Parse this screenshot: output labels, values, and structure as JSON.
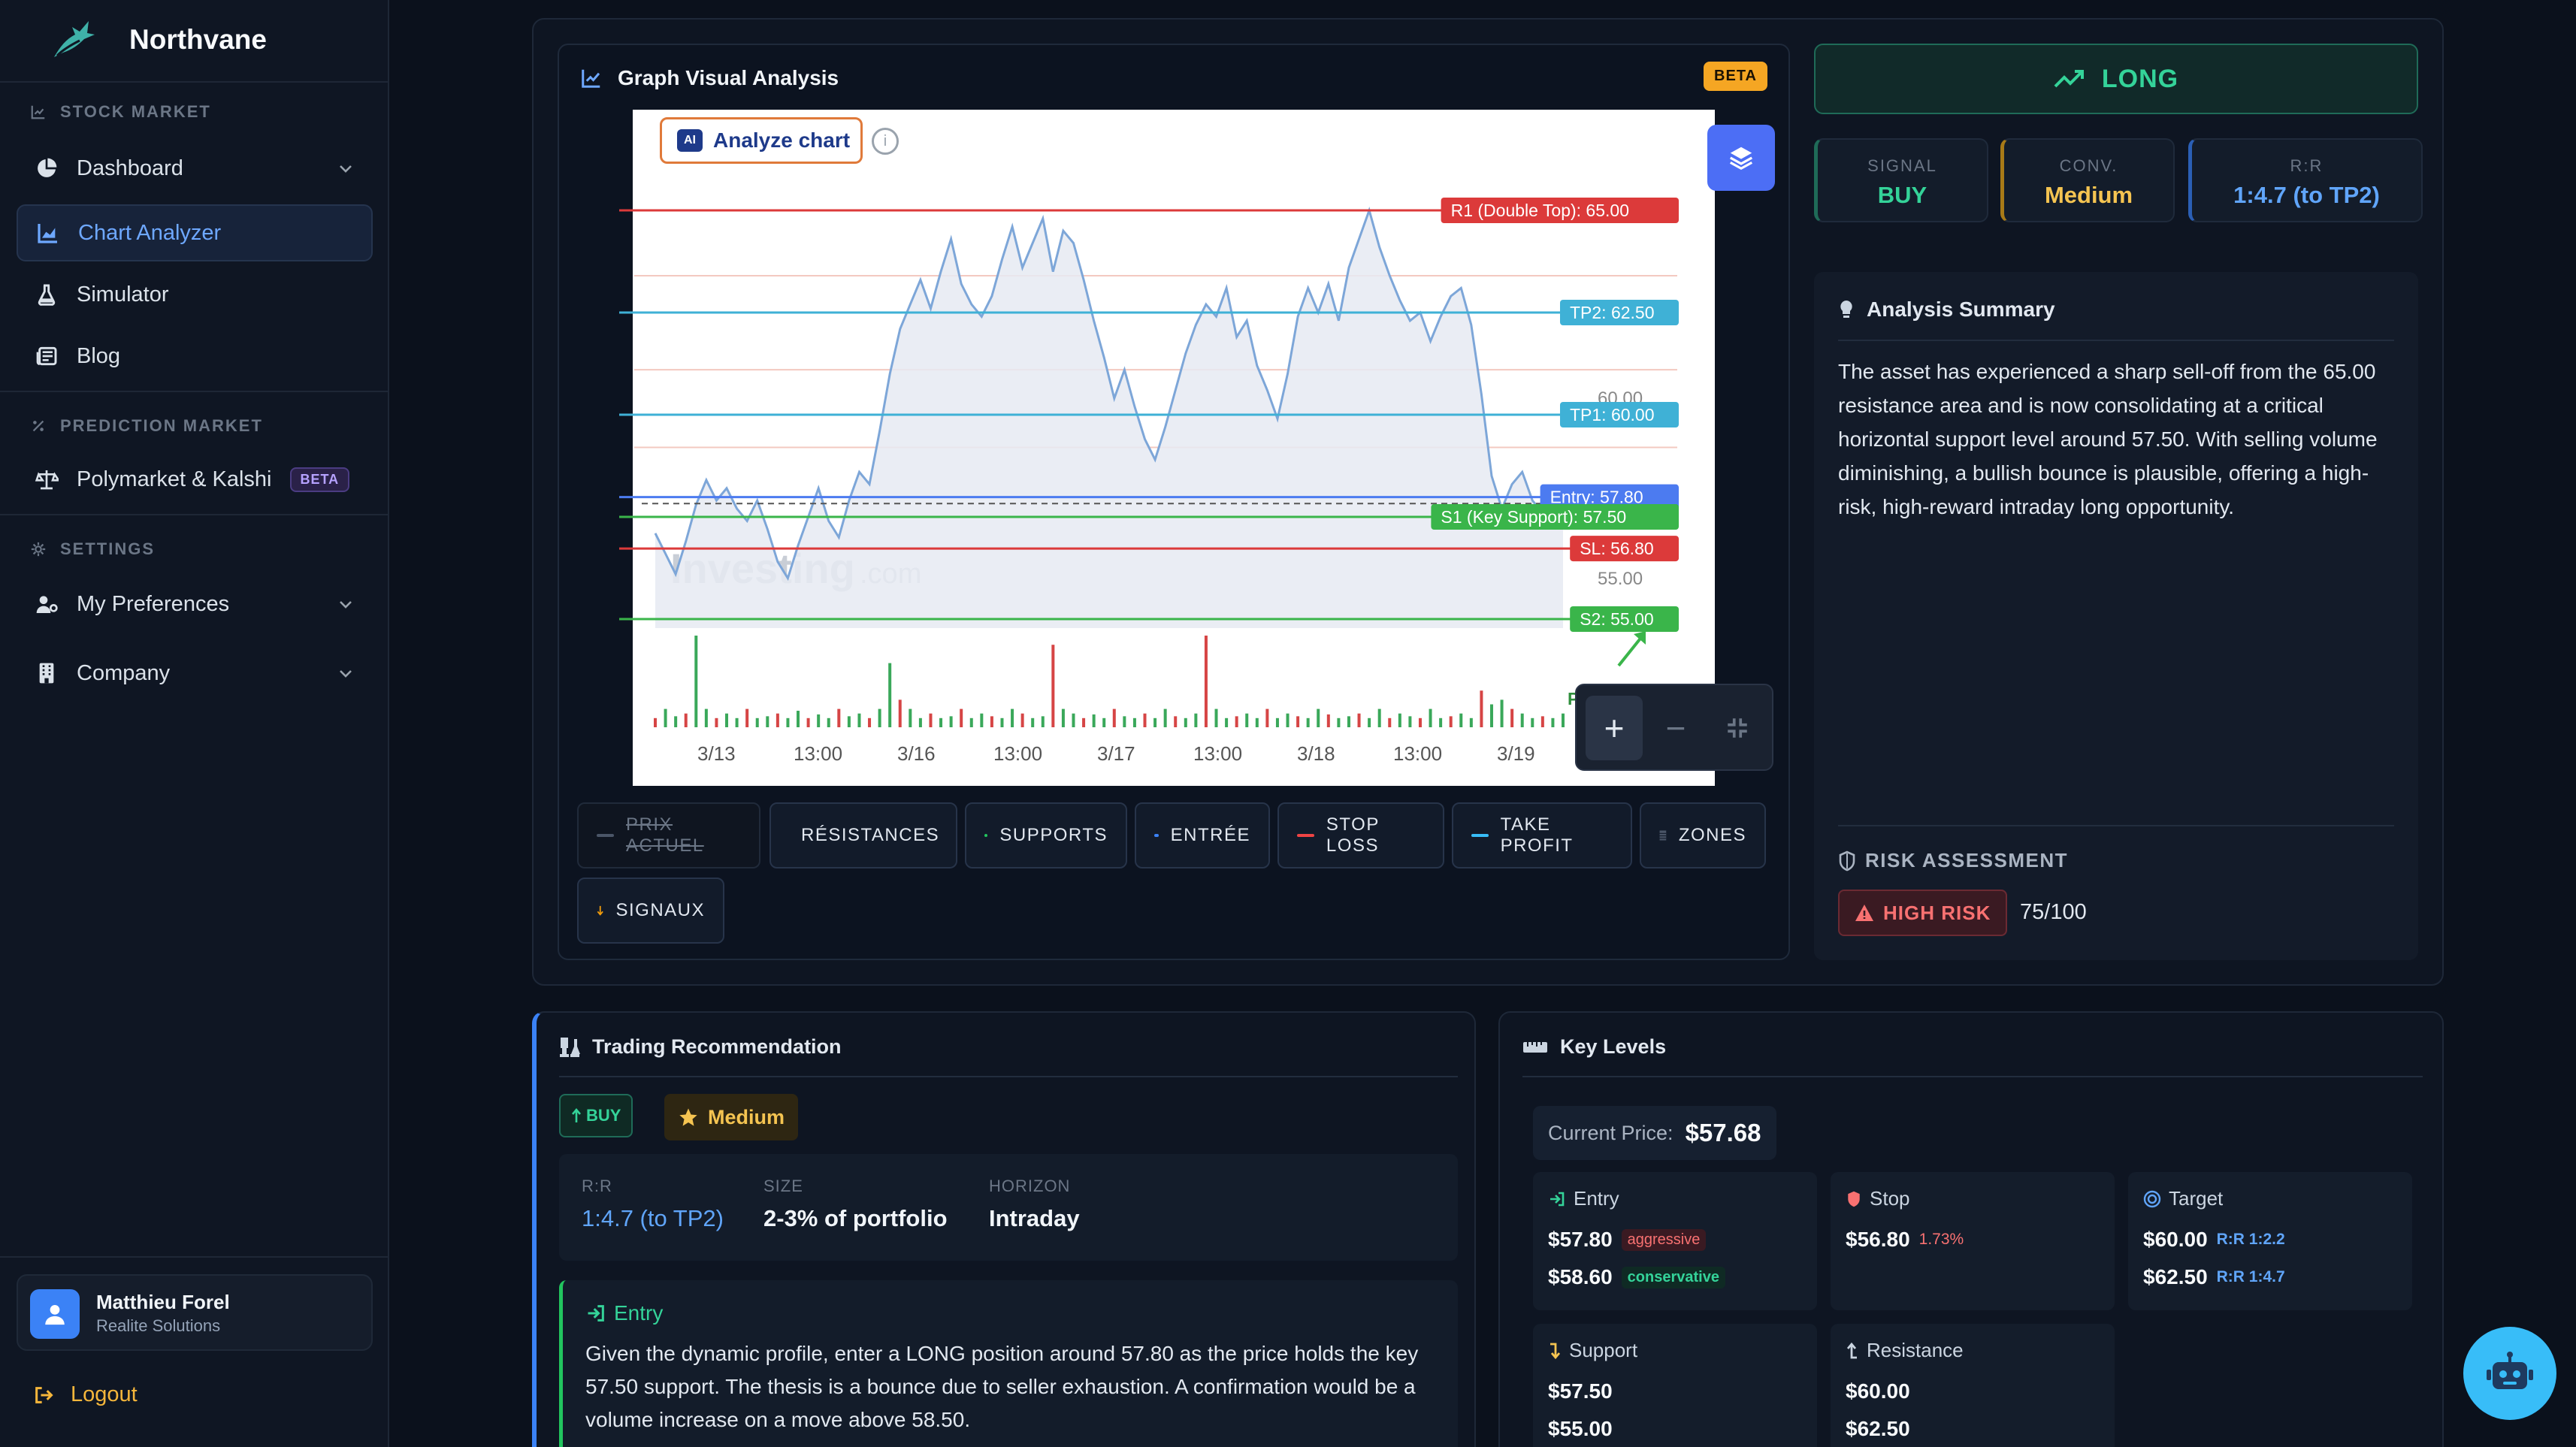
{
  "brand": {
    "name": "Northvane"
  },
  "sidebar": {
    "sections": [
      {
        "label": "STOCK MARKET"
      },
      {
        "label": "PREDICTION MARKET"
      },
      {
        "label": "SETTINGS"
      }
    ],
    "items": [
      {
        "label": "Dashboard"
      },
      {
        "label": "Chart Analyzer"
      },
      {
        "label": "Simulator"
      },
      {
        "label": "Blog"
      },
      {
        "label": "Polymarket & Kalshi",
        "badge": "BETA"
      },
      {
        "label": "My Preferences"
      },
      {
        "label": "Company"
      }
    ],
    "user": {
      "name": "Matthieu Forel",
      "org": "Realite Solutions"
    },
    "logout": "Logout"
  },
  "analysis": {
    "title": "Graph Visual Analysis",
    "beta": "BETA",
    "analyze_label": "Analyze chart",
    "ai_badge": "AI",
    "info": "i",
    "watermark": "Investing",
    "watermark_suffix": ".com",
    "zoom": {
      "in": "+",
      "out": "−"
    },
    "toggles": [
      {
        "label": "PRIX ACTUEL",
        "color": "#6b7686",
        "off": true
      },
      {
        "label": "RÉSISTANCES",
        "color": "#ef4444"
      },
      {
        "label": "SUPPORTS",
        "color": "#22c55e"
      },
      {
        "label": "ENTRÉE",
        "color": "#3b82f6"
      },
      {
        "label": "STOP LOSS",
        "color": "#ef4444"
      },
      {
        "label": "TAKE PROFIT",
        "color": "#38bdf8"
      },
      {
        "label": "ZONES",
        "color": "#6b7686"
      },
      {
        "label": "SIGNAUX",
        "color": "#f59e0b"
      }
    ]
  },
  "chart_data": {
    "type": "area",
    "x_ticks": [
      "3/13",
      "13:00",
      "3/16",
      "13:00",
      "3/17",
      "13:00",
      "3/18",
      "13:00",
      "3/19"
    ],
    "y_ticks": [
      "60.00",
      "55.00"
    ],
    "current_price_label": "57.68",
    "levels": [
      {
        "label": "R1 (Double Top): 65.00",
        "value": 65.0,
        "color": "#dc3a3a"
      },
      {
        "label": "TP2: 62.50",
        "value": 62.5,
        "color": "#3fb1d6"
      },
      {
        "label": "TP1: 60.00",
        "value": 60.0,
        "color": "#3fb1d6"
      },
      {
        "label": "Entry: 57.80",
        "value": 57.8,
        "color": "#4c7bf0"
      },
      {
        "label": "S1 (Key Support): 57.50",
        "value": 57.5,
        "color": "#3ab54a"
      },
      {
        "label": "SL: 56.80",
        "value": 56.8,
        "color": "#dc3a3a"
      },
      {
        "label": "S2: 55.00",
        "value": 55.0,
        "color": "#3ab54a"
      }
    ],
    "annotation": "Potential Bounce",
    "price": [
      57.1,
      56.6,
      56.1,
      56.9,
      57.8,
      58.4,
      57.9,
      58.2,
      57.7,
      57.4,
      57.9,
      57.2,
      56.4,
      56.0,
      56.8,
      57.5,
      58.2,
      57.4,
      57.0,
      57.9,
      58.6,
      58.3,
      59.6,
      61.0,
      62.1,
      62.7,
      63.3,
      62.6,
      63.5,
      64.3,
      63.2,
      62.7,
      62.4,
      62.9,
      63.8,
      64.6,
      63.6,
      64.2,
      64.8,
      63.5,
      64.5,
      64.2,
      63.3,
      62.3,
      61.4,
      60.4,
      61.1,
      60.2,
      59.4,
      58.9,
      59.7,
      60.6,
      61.5,
      62.2,
      62.7,
      62.4,
      63.1,
      61.9,
      62.3,
      61.2,
      60.6,
      59.9,
      61.0,
      62.4,
      63.1,
      62.5,
      63.2,
      62.3,
      63.6,
      64.3,
      65.0,
      64.1,
      63.4,
      62.8,
      62.3,
      62.5,
      61.8,
      62.4,
      62.9,
      63.1,
      62.2,
      60.5,
      58.5,
      57.7,
      58.3,
      58.6,
      57.9,
      57.6,
      58.0,
      57.68
    ],
    "volume": [
      0.1,
      0.2,
      0.12,
      0.15,
      1.0,
      0.2,
      0.1,
      0.15,
      0.1,
      0.2,
      0.1,
      0.12,
      0.15,
      0.1,
      0.18,
      0.1,
      0.14,
      0.1,
      0.2,
      0.12,
      0.15,
      0.1,
      0.2,
      0.7,
      0.3,
      0.2,
      0.1,
      0.15,
      0.1,
      0.12,
      0.2,
      0.1,
      0.15,
      0.12,
      0.1,
      0.2,
      0.15,
      0.1,
      0.12,
      0.9,
      0.2,
      0.15,
      0.1,
      0.14,
      0.1,
      0.2,
      0.12,
      0.1,
      0.15,
      0.1,
      0.2,
      0.12,
      0.1,
      0.15,
      1.0,
      0.2,
      0.1,
      0.12,
      0.15,
      0.1,
      0.2,
      0.1,
      0.15,
      0.12,
      0.1,
      0.2,
      0.14,
      0.1,
      0.12,
      0.15,
      0.1,
      0.2,
      0.1,
      0.15,
      0.12,
      0.1,
      0.2,
      0.1,
      0.12,
      0.15,
      0.1,
      0.4,
      0.25,
      0.3,
      0.2,
      0.15,
      0.1,
      0.12,
      0.1,
      0.15
    ]
  },
  "signal_panel": {
    "direction": "LONG",
    "stats": [
      {
        "label": "SIGNAL",
        "value": "BUY",
        "color": "#34d399",
        "border": "#1f6b58"
      },
      {
        "label": "CONV.",
        "value": "Medium",
        "color": "#f5c451",
        "border": "#a87a17"
      },
      {
        "label": "R:R",
        "value": "1:4.7 (to TP2)",
        "color": "#60a5fa",
        "border": "#2b5fb5"
      }
    ],
    "summary_title": "Analysis Summary",
    "summary": "The asset has experienced a sharp sell-off from the 65.00 resistance area and is now consolidating at a critical horizontal support level around 57.50. With selling volume diminishing, a bullish bounce is plausible, offering a high-risk, high-reward intraday long opportunity.",
    "risk_title": "RISK ASSESSMENT",
    "risk_label": "HIGH RISK",
    "risk_score": "75/100"
  },
  "recommendation": {
    "title": "Trading Recommendation",
    "buy": "BUY",
    "conviction": "Medium",
    "fields": [
      {
        "label": "R:R",
        "value": "1:4.7 (to TP2)"
      },
      {
        "label": "SIZE",
        "value": "2-3% of portfolio"
      },
      {
        "label": "HORIZON",
        "value": "Intraday"
      }
    ],
    "entry_title": "Entry",
    "entry_text": "Given the dynamic profile, enter a LONG position around 57.80 as the price holds the key 57.50 support. The thesis is a bounce due to seller exhaustion. A confirmation would be a volume increase on a move above 58.50."
  },
  "key_levels": {
    "title": "Key Levels",
    "current_label": "Current Price:",
    "current_value": "$57.68",
    "entry": {
      "title": "Entry",
      "rows": [
        {
          "value": "$57.80",
          "tag": "aggressive"
        },
        {
          "value": "$58.60",
          "tag": "conservative"
        }
      ]
    },
    "stop": {
      "title": "Stop",
      "rows": [
        {
          "value": "$56.80",
          "tag": "1.73%"
        }
      ]
    },
    "target": {
      "title": "Target",
      "rows": [
        {
          "value": "$60.00",
          "tag": "R:R 1:2.2"
        },
        {
          "value": "$62.50",
          "tag": "R:R 1:4.7"
        }
      ]
    },
    "support": {
      "title": "Support",
      "rows": [
        {
          "value": "$57.50"
        },
        {
          "value": "$55.00"
        }
      ]
    },
    "resistance": {
      "title": "Resistance",
      "rows": [
        {
          "value": "$60.00"
        },
        {
          "value": "$62.50"
        }
      ]
    }
  }
}
